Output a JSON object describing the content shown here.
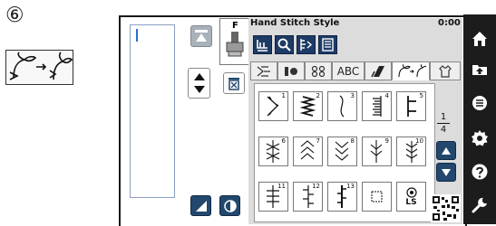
{
  "step_label": "⑥",
  "colors": {
    "screen_border": "#1a1a1a",
    "nav_background": "#1c1c1c",
    "panel_background": "#dcdcdc",
    "tool_button": "#1e3b66",
    "pattern_button_dark": "#23476d",
    "cursor": "#2a6fd0"
  },
  "category_icon": "decorative-stitch-category-icon",
  "left_panel": {
    "foot_letter": "F",
    "buttons": [
      "jump-to-top-icon",
      "presser-foot-icon",
      "cursor-up-icon",
      "cursor-down-icon",
      "delete-icon",
      "stitch-edit-icon",
      "mirror-icon"
    ]
  },
  "header": {
    "title": "Hand Stitch Style",
    "time": "0:00"
  },
  "toolbar": [
    "presser-foot-settings-icon",
    "zoom-icon",
    "stitch-combine-icon",
    "list-icon"
  ],
  "tabs": [
    {
      "icon": "utility-stitch-icon",
      "label": ""
    },
    {
      "icon": "buttonhole-icon",
      "label": ""
    },
    {
      "icon": "decorative-stitch-icon",
      "label": ""
    },
    {
      "icon": "",
      "label": "ABC"
    },
    {
      "icon": "satin-stitch-icon",
      "label": ""
    },
    {
      "icon": "hand-stitch-style-icon",
      "label": "",
      "active": true
    },
    {
      "icon": "my-stitch-icon",
      "label": ""
    }
  ],
  "stitches": [
    {
      "number": "1",
      "icon": "zigzag-arrow-stitch-icon"
    },
    {
      "number": "2",
      "icon": "serpentine-stitch-icon"
    },
    {
      "number": "3",
      "icon": "curve-stitch-icon"
    },
    {
      "number": "4",
      "icon": "ladder-left-stitch-icon"
    },
    {
      "number": "5",
      "icon": "blanket-stitch-icon"
    },
    {
      "number": "6",
      "icon": "asterisk-stitch-icon"
    },
    {
      "number": "7",
      "icon": "chevron-stitch-icon"
    },
    {
      "number": "8",
      "icon": "feather-chevron-stitch-icon"
    },
    {
      "number": "9",
      "icon": "feather-stitch-icon"
    },
    {
      "number": "10",
      "icon": "fern-stitch-icon"
    },
    {
      "number": "11",
      "icon": "cross-bar-stitch-icon"
    },
    {
      "number": "12",
      "icon": "rail-stitch-icon"
    },
    {
      "number": "13",
      "icon": "scallop-bar-stitch-icon"
    },
    {
      "number": "",
      "icon": "empty-square-stitch-icon"
    },
    {
      "number": "",
      "icon": "long-stitch-icon",
      "label": "LS"
    }
  ],
  "page_indicator": {
    "current": "1",
    "total": "4"
  },
  "scroll_buttons": [
    "page-up-icon",
    "page-down-icon"
  ],
  "qr_icon": "qr-code-icon",
  "nav": [
    "home-icon",
    "upload-icon",
    "menu-icon",
    "settings-icon",
    "help-icon",
    "wrench-icon"
  ]
}
